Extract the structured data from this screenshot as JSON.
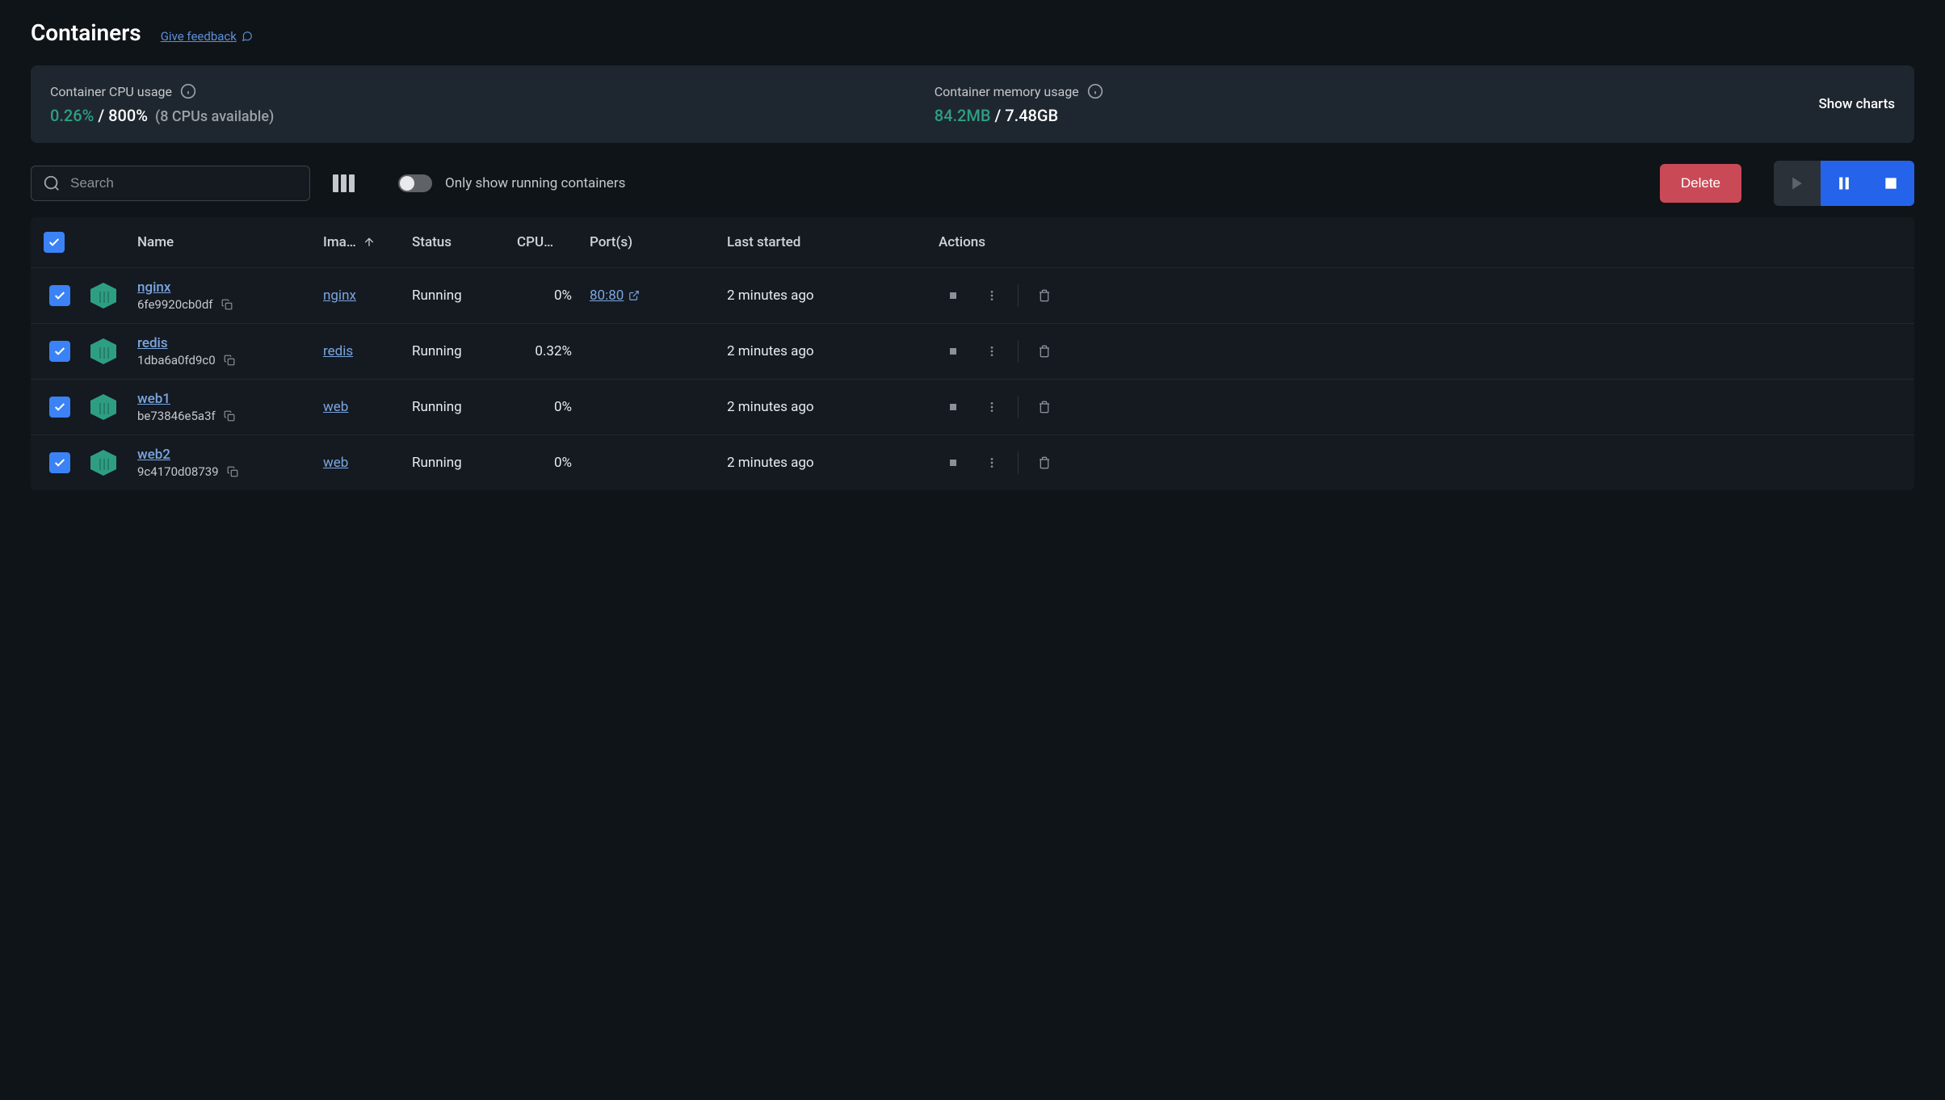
{
  "header": {
    "title": "Containers",
    "feedback": "Give feedback"
  },
  "stats": {
    "cpu": {
      "label": "Container CPU usage",
      "value": "0.26%",
      "total": "800%",
      "note": "(8 CPUs available)"
    },
    "memory": {
      "label": "Container memory usage",
      "value": "84.2MB",
      "total": "7.48GB"
    },
    "show_charts": "Show charts"
  },
  "toolbar": {
    "search_placeholder": "Search",
    "toggle_label": "Only show running containers",
    "delete_label": "Delete"
  },
  "table": {
    "headers": {
      "name": "Name",
      "image": "Ima…",
      "status": "Status",
      "cpu": "CPU…",
      "ports": "Port(s)",
      "last_started": "Last started",
      "actions": "Actions"
    },
    "rows": [
      {
        "name": "nginx",
        "id": "6fe9920cb0df",
        "image": "nginx",
        "status": "Running",
        "cpu": "0%",
        "port": "80:80",
        "last_started": "2 minutes ago"
      },
      {
        "name": "redis",
        "id": "1dba6a0fd9c0",
        "image": "redis",
        "status": "Running",
        "cpu": "0.32%",
        "port": "",
        "last_started": "2 minutes ago"
      },
      {
        "name": "web1",
        "id": "be73846e5a3f",
        "image": "web",
        "status": "Running",
        "cpu": "0%",
        "port": "",
        "last_started": "2 minutes ago"
      },
      {
        "name": "web2",
        "id": "9c4170d08739",
        "image": "web",
        "status": "Running",
        "cpu": "0%",
        "port": "",
        "last_started": "2 minutes ago"
      }
    ]
  }
}
